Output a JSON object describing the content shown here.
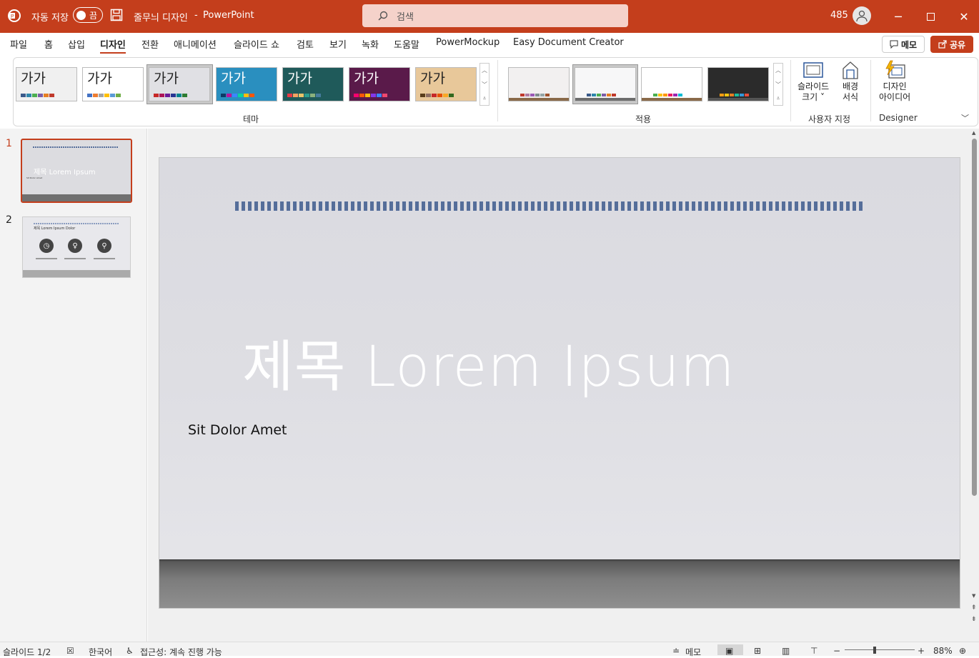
{
  "titlebar": {
    "autosave_label": "자동 저장",
    "autosave_state": "끔",
    "doc_title": "줄무늬 디자인",
    "separator": "-",
    "app_name": "PowerPoint",
    "search_placeholder": "검색",
    "user_count": "485",
    "accent_color": "#c43e1c"
  },
  "tabs": [
    "파일",
    "홈",
    "삽입",
    "디자인",
    "전환",
    "애니메이션",
    "슬라이드 쇼",
    "검토",
    "보기",
    "녹화",
    "도움말",
    "PowerMockup",
    "Easy Document Creator"
  ],
  "active_tab": "디자인",
  "actions": {
    "memo": "메모",
    "share": "공유"
  },
  "ribbon": {
    "themes": [
      {
        "label": "가가",
        "bg": "#f0f0f0",
        "dots": [
          "#3a5a8a",
          "#2e86ab",
          "#4caf50",
          "#7b5ea7",
          "#e67e22",
          "#c0392b"
        ]
      },
      {
        "label": "가가",
        "bg": "#ffffff",
        "dots": [
          "#4472c4",
          "#ed7d31",
          "#a5a5a5",
          "#ffc000",
          "#5b9bd5",
          "#70ad47"
        ]
      },
      {
        "label": "가가",
        "bg": "#e0e0e4",
        "dots": [
          "#c62828",
          "#ad1457",
          "#6a1b9a",
          "#283593",
          "#00838f",
          "#2e7d32"
        ]
      },
      {
        "label": "가가",
        "bg": "#2a8fbf",
        "dots": [
          "#0d3b66",
          "#b5179e",
          "#3a86ff",
          "#06d6a0",
          "#ffbe0b",
          "#fb5607"
        ]
      },
      {
        "label": "가가",
        "bg": "#1f5a5a",
        "dots": [
          "#e63946",
          "#f4a261",
          "#e9c46a",
          "#2a9d8f",
          "#8ab17d",
          "#457b9d"
        ]
      },
      {
        "label": "가가",
        "bg": "#5a1a4a",
        "dots": [
          "#ff006e",
          "#fb5607",
          "#ffbe0b",
          "#8338ec",
          "#3a86ff",
          "#ef476f"
        ]
      },
      {
        "label": "가가",
        "bg": "#e8c89a",
        "dots": [
          "#5a3e1b",
          "#8d6e63",
          "#c62828",
          "#e65100",
          "#f9a825",
          "#33691e"
        ]
      }
    ],
    "themes_group": "테마",
    "variants": [
      {
        "bg": "#f2f0f0",
        "floor": "#8a6a4a",
        "dots": [
          "#c0392b",
          "#b07aa1",
          "#9b59b6",
          "#7f8c8d",
          "#95a5a6",
          "#a0522d"
        ]
      },
      {
        "bg": "#f7f7f8",
        "floor": "#6d6d6d",
        "dots": [
          "#3a5a8a",
          "#2e86ab",
          "#4caf50",
          "#7b5ea7",
          "#e67e22",
          "#c0392b"
        ]
      },
      {
        "bg": "#ffffff",
        "floor": "#8a6a4a",
        "dots": [
          "#4caf50",
          "#ffc107",
          "#ff9800",
          "#e91e63",
          "#9c27b0",
          "#00bcd4"
        ]
      },
      {
        "bg": "#2b2b2b",
        "floor": "#555555",
        "dots": [
          "#f39c12",
          "#f1c40f",
          "#e67e22",
          "#1abc9c",
          "#3498db",
          "#e74c3c"
        ]
      }
    ],
    "variants_group": "적용",
    "slide_size_label": [
      "슬라이드",
      "크기"
    ],
    "format_bg_label": [
      "배경",
      "서식"
    ],
    "customize_group": "사용자 지정",
    "design_ideas_label": [
      "디자인",
      "아이디어"
    ],
    "designer_group": "Designer"
  },
  "slides_panel": {
    "slide1_num": "1",
    "slide1_title": "제목 Lorem Ipsum",
    "slide1_sub": "Sit Dolor Amet",
    "slide2_num": "2",
    "slide2_title": "제목 Lorem Ipsum Dolor"
  },
  "slide": {
    "title": "제목 Lorem Ipsum",
    "subtitle": "Sit Dolor Amet"
  },
  "status": {
    "slide_pos": "슬라이드 1/2",
    "language": "한국어",
    "accessibility": "접근성: 계속 진행 가능",
    "notes": "메모",
    "zoom": "88%"
  }
}
